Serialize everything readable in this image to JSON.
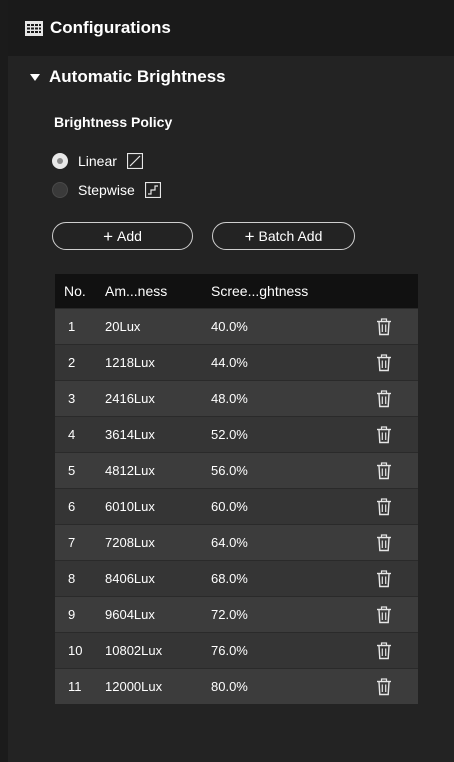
{
  "header": {
    "title": "Configurations",
    "icon": "grid-icon"
  },
  "section": {
    "label": "Automatic Brightness",
    "icon": "caret-down-icon"
  },
  "policy": {
    "title": "Brightness Policy",
    "options": [
      {
        "label": "Linear",
        "selected": true,
        "icon": "linear-curve-icon"
      },
      {
        "label": "Stepwise",
        "selected": false,
        "icon": "stepwise-curve-icon"
      }
    ]
  },
  "buttons": {
    "add": "Add",
    "batch_add": "Batch Add"
  },
  "table": {
    "columns": [
      "No.",
      "Am...ness",
      "Scree...ghtness"
    ],
    "rows": [
      {
        "no": "1",
        "ambient": "20Lux",
        "screen": "40.0%"
      },
      {
        "no": "2",
        "ambient": "1218Lux",
        "screen": "44.0%"
      },
      {
        "no": "3",
        "ambient": "2416Lux",
        "screen": "48.0%"
      },
      {
        "no": "4",
        "ambient": "3614Lux",
        "screen": "52.0%"
      },
      {
        "no": "5",
        "ambient": "4812Lux",
        "screen": "56.0%"
      },
      {
        "no": "6",
        "ambient": "6010Lux",
        "screen": "60.0%"
      },
      {
        "no": "7",
        "ambient": "7208Lux",
        "screen": "64.0%"
      },
      {
        "no": "8",
        "ambient": "8406Lux",
        "screen": "68.0%"
      },
      {
        "no": "9",
        "ambient": "9604Lux",
        "screen": "72.0%"
      },
      {
        "no": "10",
        "ambient": "10802Lux",
        "screen": "76.0%"
      },
      {
        "no": "11",
        "ambient": "12000Lux",
        "screen": "80.0%"
      }
    ],
    "row_action_icon": "trash-icon"
  },
  "colors": {
    "background": "#232323",
    "header": "#1a1a1a",
    "table_header": "#111111",
    "row_odd": "#3c3c3c",
    "row_even": "#353535",
    "text": "#ffffff"
  }
}
